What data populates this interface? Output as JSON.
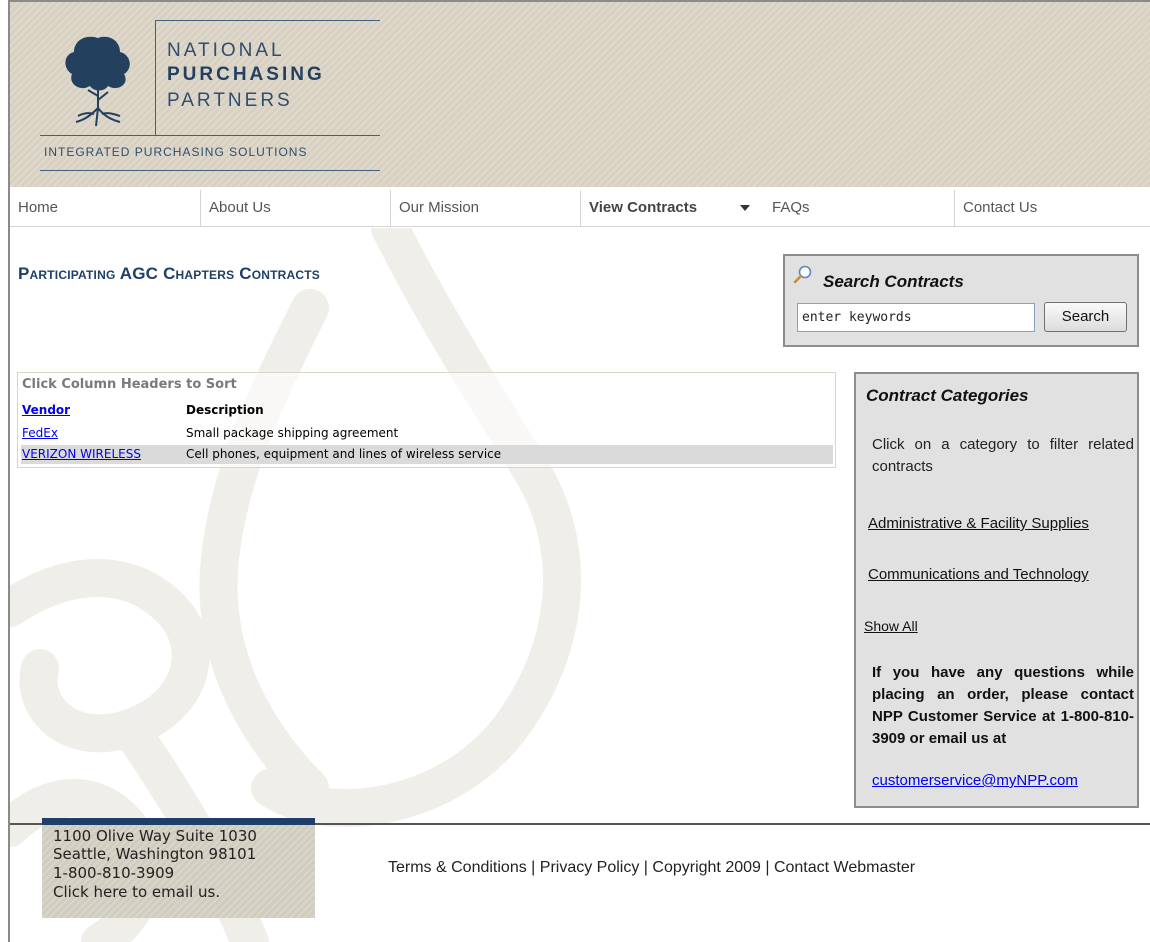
{
  "brand": {
    "line1": "NATIONAL",
    "line2": "PURCHASING",
    "line3": "PARTNERS",
    "tagline": "INTEGRATED PURCHASING SOLUTIONS",
    "colors": {
      "navy": "#23405f",
      "header_bg": "#d8d1c2"
    }
  },
  "nav": {
    "items": [
      {
        "label": "Home"
      },
      {
        "label": "About Us"
      },
      {
        "label": "Our Mission"
      },
      {
        "label": "View Contracts"
      },
      {
        "label": "FAQs"
      },
      {
        "label": "Contact Us"
      }
    ]
  },
  "page": {
    "title": "Participating AGC Chapters Contracts"
  },
  "search": {
    "title": "Search Contracts",
    "input_value": "enter keywords",
    "button_label": "Search"
  },
  "contracts": {
    "sort_hint": "Click Column Headers to Sort",
    "columns": [
      "Vendor",
      "Description"
    ],
    "rows": [
      {
        "vendor": "FedEx",
        "description": "Small package shipping agreement"
      },
      {
        "vendor": "VERIZON WIRELESS",
        "description": "Cell phones, equipment and lines of wireless service"
      }
    ]
  },
  "categories": {
    "title": "Contract Categories",
    "help": "Click on a category to filter related contracts",
    "links": [
      "Administrative & Facility Supplies",
      "Communications and Technology"
    ],
    "show_all": "Show All",
    "contact_text": "If you have any questions while placing an order, please contact NPP Customer Service at 1-800-810-3909 or email us at",
    "email": "customerservice@myNPP.com"
  },
  "footer": {
    "address": [
      "1100 Olive Way Suite 1030",
      "Seattle, Washington 98101",
      "1-800-810-3909",
      "Click here to email us."
    ],
    "links": "Terms & Conditions | Privacy Policy | Copyright 2009 | Contact Webmaster"
  }
}
